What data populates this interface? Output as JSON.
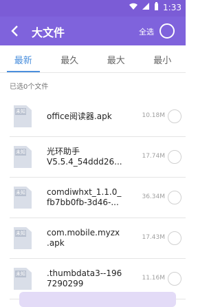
{
  "status_bar": {
    "time": "1:33"
  },
  "appbar": {
    "title": "大文件",
    "select_all": "全选"
  },
  "tabs": [
    {
      "label": "最新",
      "active": true
    },
    {
      "label": "最久",
      "active": false
    },
    {
      "label": "最大",
      "active": false
    },
    {
      "label": "最小",
      "active": false
    }
  ],
  "selected_count": "已选0个文件",
  "files": [
    {
      "tag": "未知",
      "name": "office阅读器.apk",
      "size": "10.18M"
    },
    {
      "tag": "未知",
      "name": "光环助手\nV5.5.4_54ddd26...",
      "size": "17.74M"
    },
    {
      "tag": "未知",
      "name": "comdiwhxt_1.1.0_\nfb7bb0fb-3d46-...",
      "size": "36.34M"
    },
    {
      "tag": "未知",
      "name": "com.mobile.myzx\n.apk",
      "size": "17.43M"
    },
    {
      "tag": "未知",
      "name": ".thumbdata3--196\n7290299",
      "size": "11.16M"
    }
  ],
  "colors": {
    "accent": "#7f63dc",
    "tab_active": "#4a8fdd"
  }
}
